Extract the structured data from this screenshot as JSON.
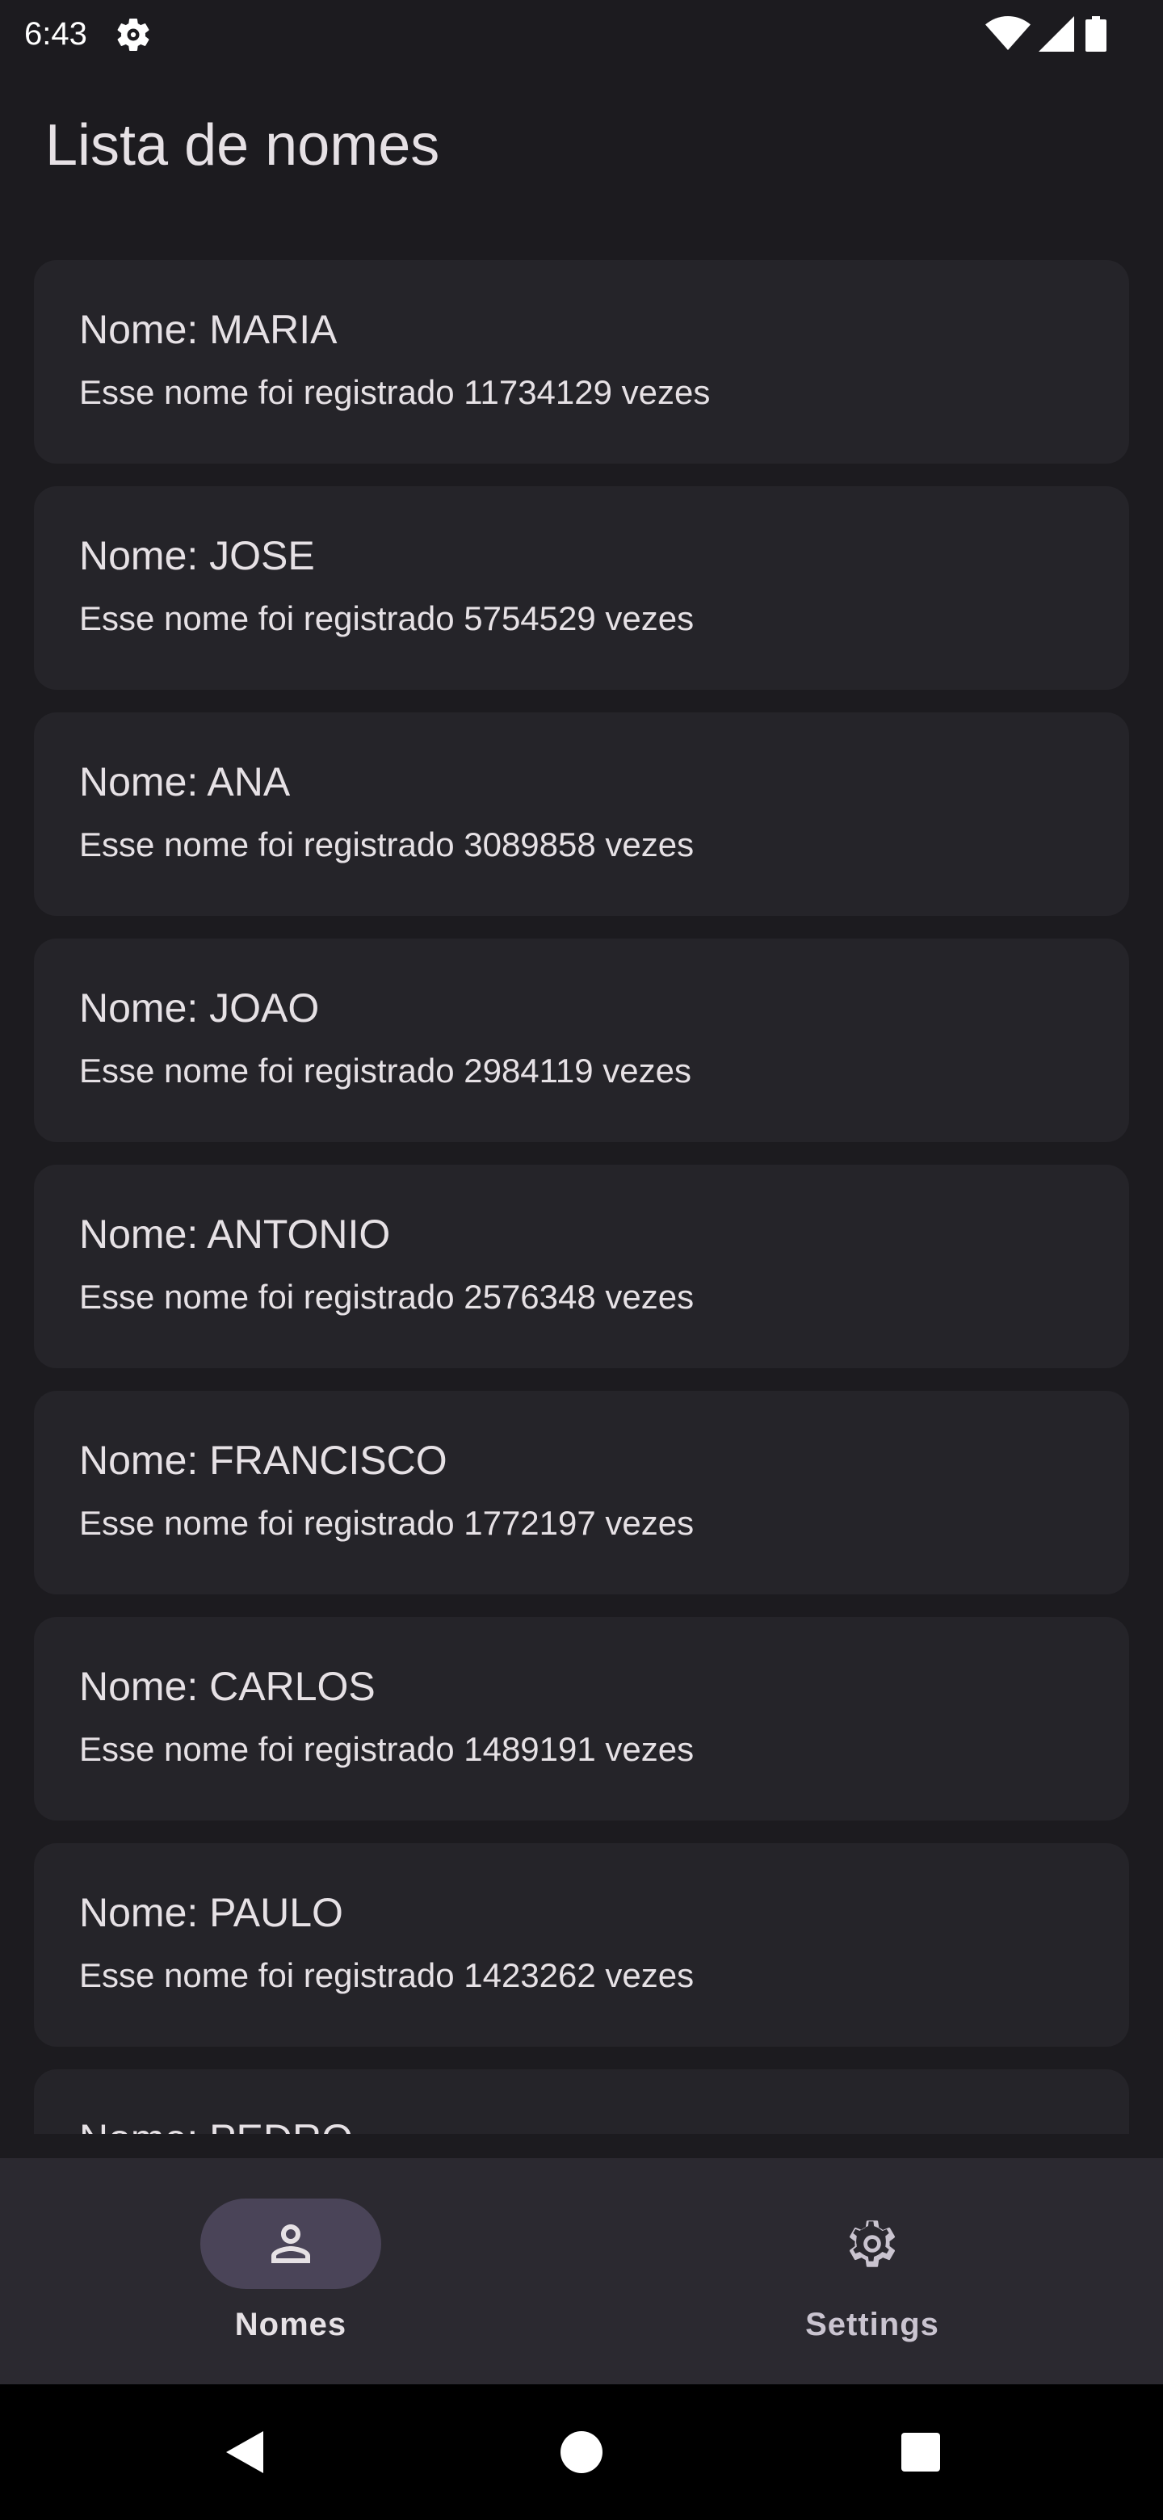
{
  "status_bar": {
    "time": "6:43",
    "icons": [
      "settings-gear-icon",
      "wifi-icon",
      "cellular-signal-icon",
      "battery-icon"
    ]
  },
  "app_bar": {
    "title": "Lista de nomes"
  },
  "names": [
    {
      "name": "Nome: MARIA",
      "description": "Esse nome foi registrado 11734129 vezes"
    },
    {
      "name": "Nome: JOSE",
      "description": "Esse nome foi registrado 5754529 vezes"
    },
    {
      "name": "Nome: ANA",
      "description": "Esse nome foi registrado 3089858 vezes"
    },
    {
      "name": "Nome: JOAO",
      "description": "Esse nome foi registrado 2984119 vezes"
    },
    {
      "name": "Nome: ANTONIO",
      "description": "Esse nome foi registrado 2576348 vezes"
    },
    {
      "name": "Nome: FRANCISCO",
      "description": "Esse nome foi registrado 1772197 vezes"
    },
    {
      "name": "Nome: CARLOS",
      "description": "Esse nome foi registrado 1489191 vezes"
    },
    {
      "name": "Nome: PAULO",
      "description": "Esse nome foi registrado 1423262 vezes"
    },
    {
      "name": "Nome: PEDRO",
      "description": ""
    }
  ],
  "bottom_nav": {
    "items": [
      {
        "label": "Nomes",
        "icon": "person-icon",
        "selected": true
      },
      {
        "label": "Settings",
        "icon": "settings-icon",
        "selected": false
      }
    ]
  },
  "system_nav": {
    "icons": [
      "back-icon",
      "home-icon",
      "recents-icon"
    ]
  },
  "colors": {
    "background": "#1c1b1f",
    "card": "#252429",
    "nav_bar": "#2b2930",
    "nav_indicator": "#4a4458",
    "text": "#e6e1e5"
  }
}
